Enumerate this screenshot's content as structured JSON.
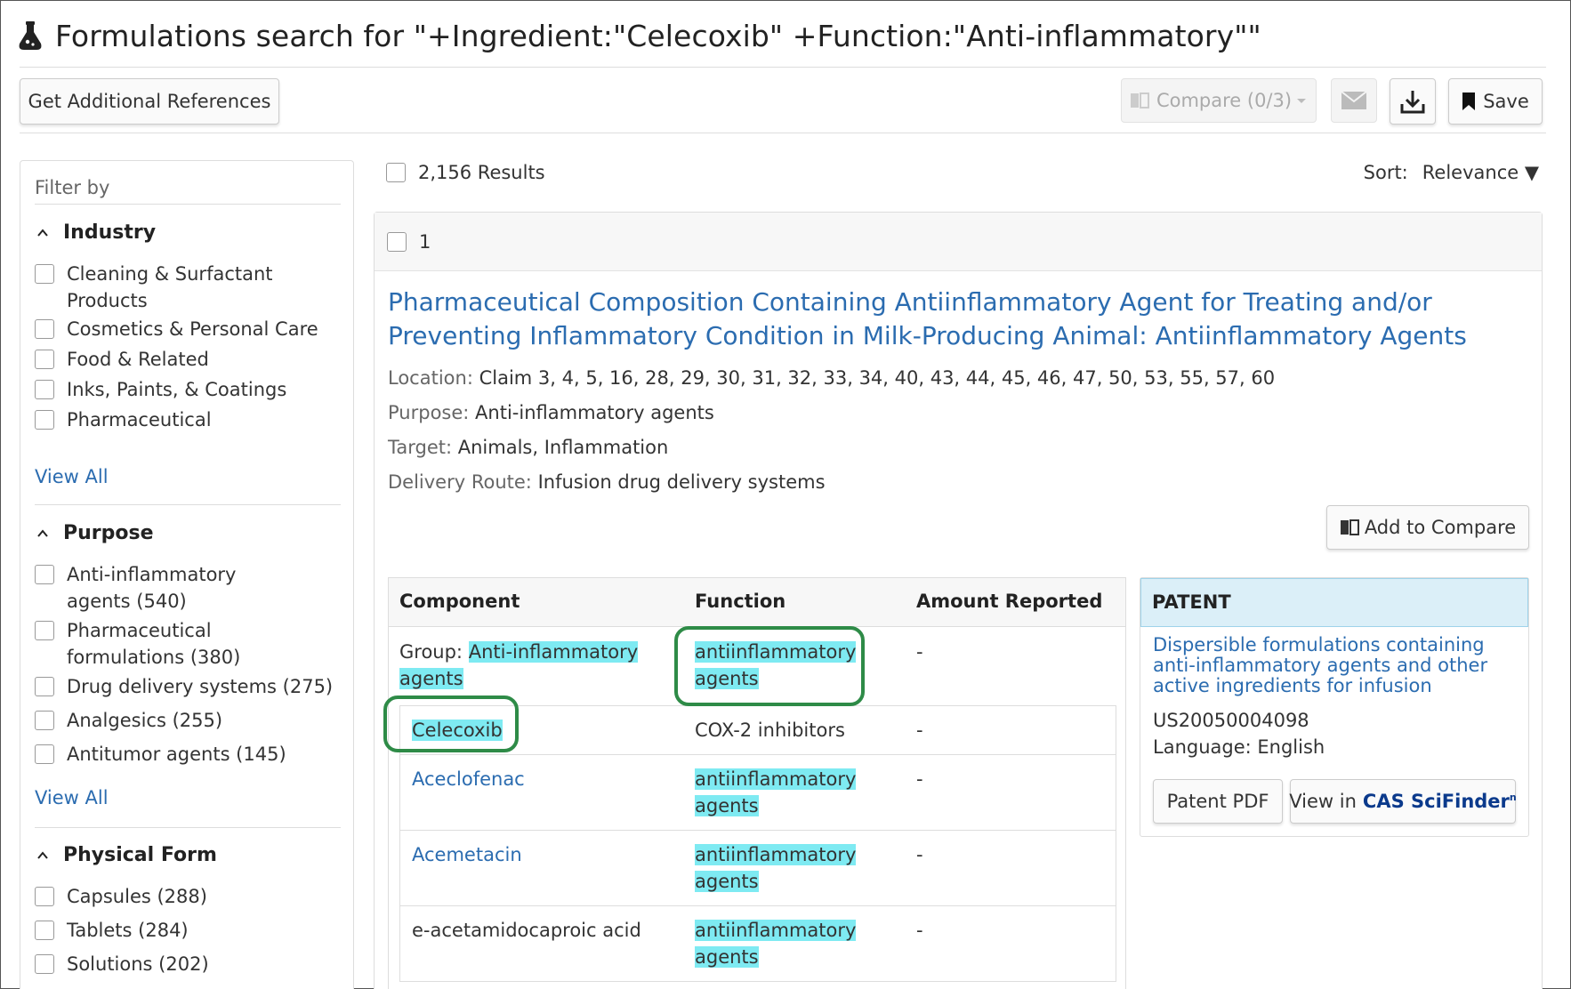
{
  "header": {
    "title": "Formulations search for \"+Ingredient:\"Celecoxib\" +Function:\"Anti-inflammatory\"\""
  },
  "toolbar": {
    "get_refs_label": "Get Additional References",
    "compare_label": "Compare (0/3)",
    "save_label": "Save"
  },
  "sidebar": {
    "filter_by": "Filter by",
    "facets": [
      {
        "title": "Industry",
        "items": [
          "Cleaning & Surfactant Products",
          "Cosmetics & Personal Care",
          "Food & Related",
          "Inks, Paints, & Coatings",
          "Pharmaceutical"
        ],
        "view_all": "View All"
      },
      {
        "title": "Purpose",
        "items": [
          "Anti-inflammatory agents (540)",
          "Pharmaceutical formulations (380)",
          "Drug delivery systems (275)",
          "Analgesics (255)",
          "Antitumor agents (145)"
        ],
        "view_all": "View All"
      },
      {
        "title": "Physical Form",
        "items": [
          "Capsules (288)",
          "Tablets (284)",
          "Solutions (202)"
        ]
      }
    ]
  },
  "results": {
    "count_label": "2,156 Results",
    "sort_label": "Sort:",
    "sort_value": "Relevance ▼"
  },
  "result": {
    "index": "1",
    "title": "Pharmaceutical Composition Containing Antiinflammatory Agent for Treating and/or Preventing Inflammatory Condition in Milk-Producing Animal: Antiinflammatory Agents",
    "meta": [
      {
        "key": "Location:",
        "value": "Claim 3, 4, 5, 16, 28, 29, 30, 31, 32, 33, 34, 40, 43, 44, 45, 46, 47, 50, 53, 55, 57, 60"
      },
      {
        "key": "Purpose:",
        "value": "Anti-inflammatory agents"
      },
      {
        "key": "Target:",
        "value": "Animals, Inflammation"
      },
      {
        "key": "Delivery Route:",
        "value": "Infusion drug delivery systems"
      }
    ],
    "add_compare_label": "Add to Compare",
    "table": {
      "headers": [
        "Component",
        "Function",
        "Amount Reported"
      ],
      "group": {
        "prefix": "Group:",
        "component_line1": "Anti-inflammatory",
        "component_line2": "agents",
        "function_line1": "antiinflammatory",
        "function_line2": "agents",
        "amount": "-"
      },
      "rows": [
        {
          "component": "Celecoxib",
          "function_line1": "COX-2 inhibitors",
          "function_line2": "",
          "amount": "-"
        },
        {
          "component": "Aceclofenac",
          "function_line1": "antiinflammatory",
          "function_line2": "agents",
          "amount": "-"
        },
        {
          "component": "Acemetacin",
          "function_line1": "antiinflammatory",
          "function_line2": "agents",
          "amount": "-"
        },
        {
          "component": "e-acetamidocaproic acid",
          "function_line1": "antiinflammatory",
          "function_line2": "agents",
          "amount": "-"
        }
      ]
    },
    "patent": {
      "heading": "PATENT",
      "title": "Dispersible formulations containing anti-inflammatory agents and other active ingredients for infusion",
      "number": "US20050004098",
      "language": "Language: English",
      "pdf_label": "Patent PDF",
      "view_in": "View in",
      "cas_brand": "CAS SciFinder",
      "cas_sup": "n"
    }
  },
  "colors": {
    "link": "#2b6cb0",
    "highlight": "#7eeaf2",
    "ring": "#2e8b47",
    "patent_header": "#dbeff8"
  }
}
